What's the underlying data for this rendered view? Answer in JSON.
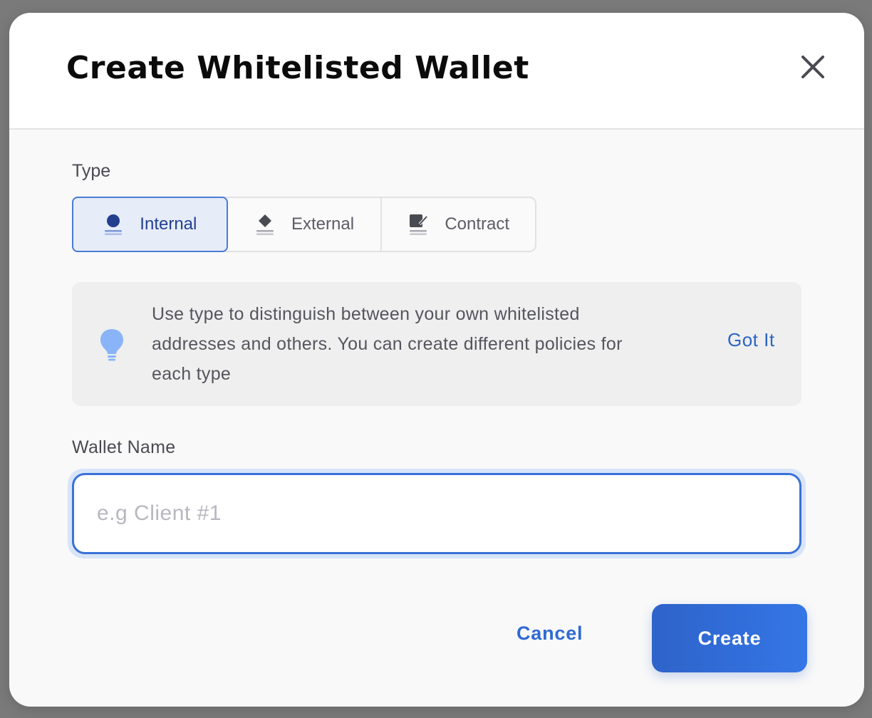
{
  "modal": {
    "title": "Create Whitelisted Wallet",
    "close_icon": "close-icon"
  },
  "type_section": {
    "label": "Type",
    "options": [
      {
        "label": "Internal",
        "icon": "coin-stack-icon",
        "selected": true
      },
      {
        "label": "External",
        "icon": "diamond-stack-icon",
        "selected": false
      },
      {
        "label": "Contract",
        "icon": "contract-sign-icon",
        "selected": false
      }
    ]
  },
  "tip": {
    "icon": "lightbulb-icon",
    "text": "Use type to distinguish between your own whitelisted addresses and others. You can create different policies for each type",
    "action_label": "Got It"
  },
  "wallet_name": {
    "label": "Wallet Name",
    "placeholder": "e.g Client #1",
    "value": ""
  },
  "actions": {
    "cancel_label": "Cancel",
    "create_label": "Create"
  },
  "colors": {
    "accent": "#2f6ad3",
    "selected_bg": "#e6ecf8",
    "selected_text": "#23408f",
    "tip_bg": "#efefef",
    "lightbulb": "#8ab4f8"
  }
}
